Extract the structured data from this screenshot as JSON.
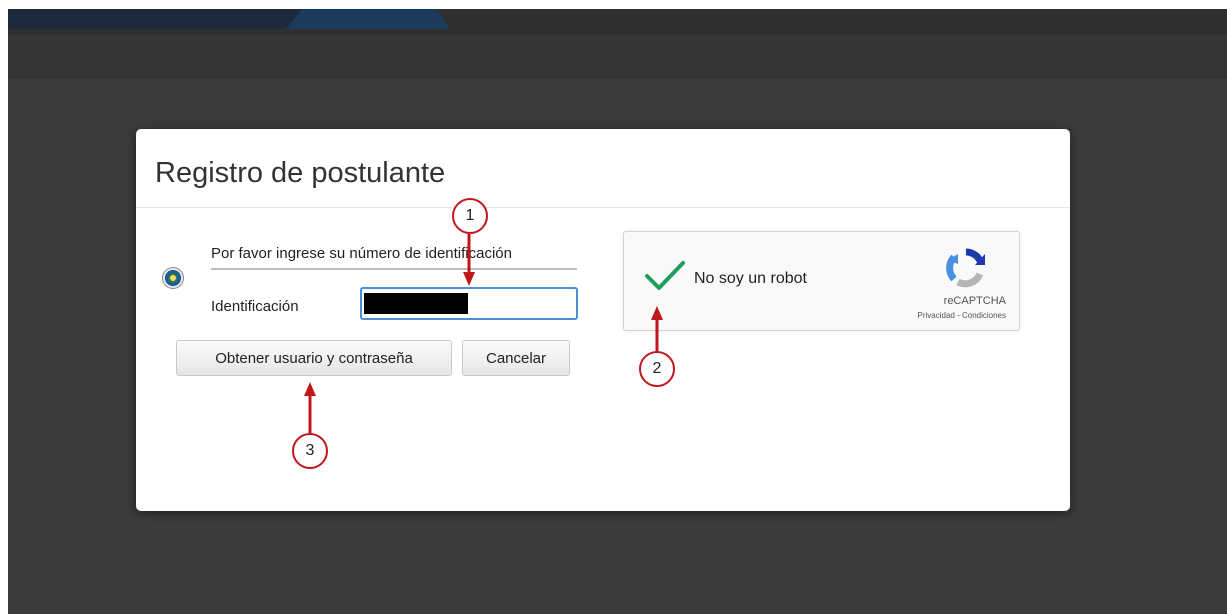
{
  "modal": {
    "title": "Registro de postulante"
  },
  "form": {
    "prompt": "Por favor ingrese su número de identificación",
    "id_label": "Identificación",
    "id_value": "",
    "seal_icon": "coat-of-arms-seal"
  },
  "buttons": {
    "obtener": "Obtener usuario y contraseña",
    "cancelar": "Cancelar"
  },
  "recaptcha": {
    "checked": true,
    "label": "No soy un robot",
    "brand": "reCAPTCHA",
    "links": "Privacidad - Condiciones",
    "check_color": "#1e9e5a"
  },
  "annotations": {
    "color": "#c0171c",
    "markers": [
      "1",
      "2",
      "3"
    ]
  }
}
